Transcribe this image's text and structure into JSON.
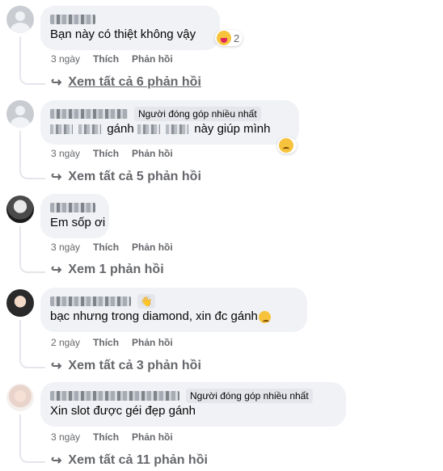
{
  "comments": [
    {
      "text": "Bạn này có thiệt không vậy",
      "reaction_count": "2",
      "time": "3 ngày",
      "like": "Thích",
      "reply": "Phản hồi",
      "replies_link": "Xem tất cả 6 phản hồi"
    },
    {
      "badge": "Người đóng góp nhiều nhất",
      "text_a": "gánh",
      "text_b": "này giúp mình",
      "time": "3 ngày",
      "like": "Thích",
      "reply": "Phản hồi",
      "replies_link": "Xem tất cả 5 phản hồi"
    },
    {
      "text": "Em sốp ơi",
      "time": "3 ngày",
      "like": "Thích",
      "reply": "Phản hồi",
      "replies_link": "Xem 1 phản hồi"
    },
    {
      "text": "bạc nhưng trong diamond, xin đc gánh",
      "time": "2 ngày",
      "like": "Thích",
      "reply": "Phản hồi",
      "replies_link": "Xem tất cả 3 phản hồi"
    },
    {
      "badge": "Người đóng góp nhiều nhất",
      "text": "Xin slot được géi đẹp gánh",
      "time": "3 ngày",
      "like": "Thích",
      "reply": "Phản hồi",
      "replies_link": "Xem tất cả 11 phản hồi"
    }
  ],
  "icons": {
    "reply_arrow": "↪",
    "wave": "👋"
  }
}
